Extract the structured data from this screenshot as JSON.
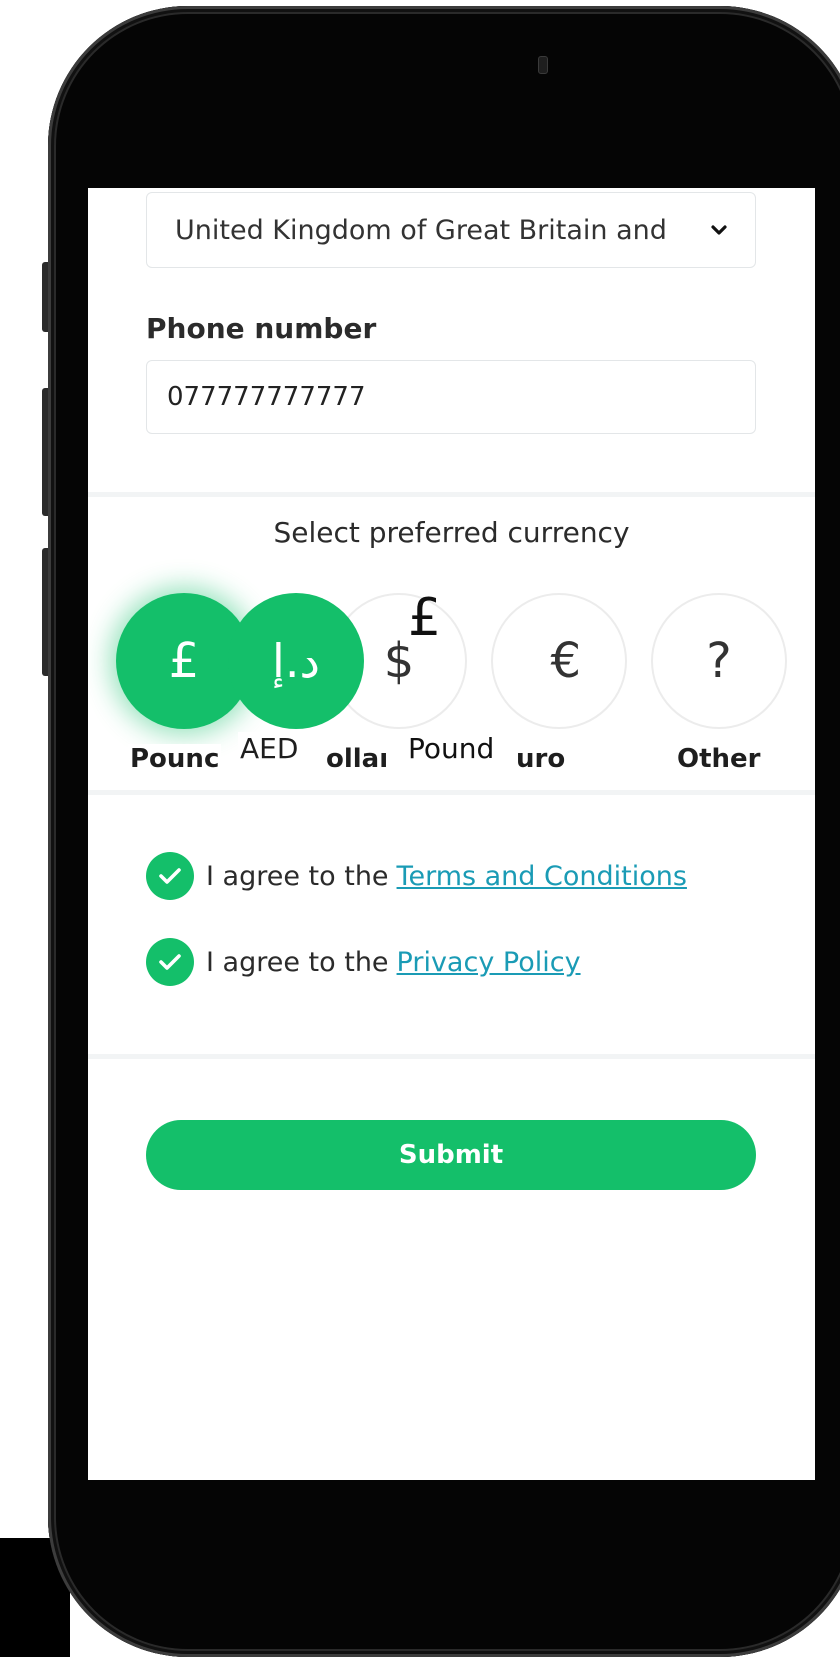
{
  "form": {
    "country_select": {
      "value": "United Kingdom of Great Britain and"
    },
    "phone": {
      "label": "Phone number",
      "value": "077777777777"
    },
    "currency": {
      "title": "Select preferred currency",
      "options": [
        {
          "symbol": "£",
          "label": "Pounc"
        },
        {
          "symbol": "د.إ",
          "label": "AED"
        },
        {
          "symbol": "$",
          "label": "ollaı"
        },
        {
          "symbol": "€",
          "label": "uro"
        },
        {
          "symbol": "?",
          "label": "Other"
        }
      ],
      "overlay": {
        "symbol": "£",
        "label": "Pound"
      }
    },
    "agreements": [
      {
        "text": "I agree to the",
        "link": "Terms and Conditions"
      },
      {
        "text": "I agree to the",
        "link": "Privacy Policy"
      }
    ],
    "submit_label": "Submit"
  },
  "colors": {
    "accent": "#14bf6a",
    "link": "#1a9bb5"
  },
  "icons": {
    "check": "check-icon",
    "dropdown": "chevron-down-icon"
  }
}
